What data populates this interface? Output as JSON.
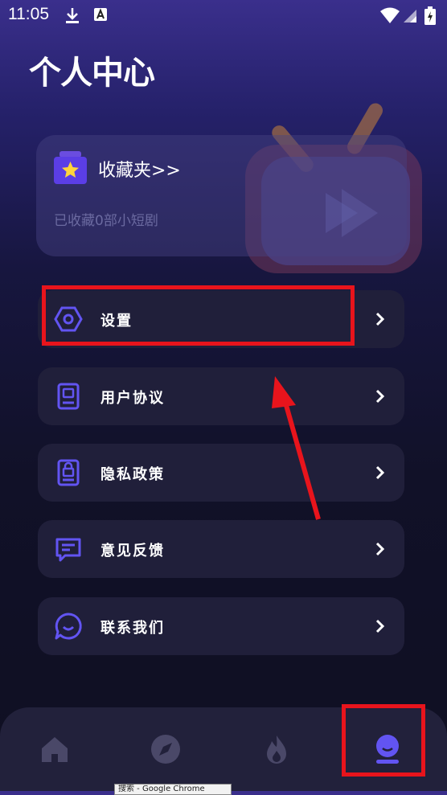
{
  "status_bar": {
    "time": "11:05"
  },
  "page": {
    "title": "个人中心"
  },
  "favorites": {
    "title": "收藏夹>>",
    "subtitle": "已收藏0部小短剧"
  },
  "menu": [
    {
      "label": "设置",
      "icon": "settings-hexagon-icon"
    },
    {
      "label": "用户协议",
      "icon": "user-agreement-icon"
    },
    {
      "label": "隐私政策",
      "icon": "privacy-lock-icon"
    },
    {
      "label": "意见反馈",
      "icon": "feedback-chat-icon"
    },
    {
      "label": "联系我们",
      "icon": "contact-chat-icon"
    }
  ],
  "tab_bar": {
    "tabs": [
      "home-icon",
      "discover-compass-icon",
      "hot-fire-icon",
      "profile-icon"
    ],
    "active": "profile-icon"
  },
  "tooltip": {
    "text": "搜索 - Google Chrome"
  },
  "colors": {
    "accent": "#5b4ff0",
    "highlight": "#e8141c",
    "card": "#201f3a"
  }
}
